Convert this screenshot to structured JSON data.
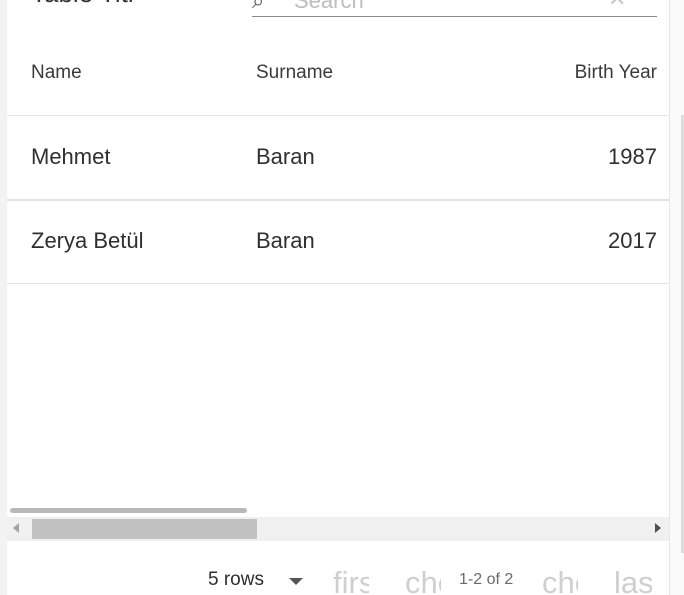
{
  "table": {
    "title": "Table Titl",
    "search": {
      "icon": "search-icon",
      "placeholder": "Search",
      "clear_icon": "clear-icon"
    },
    "columns": [
      "Name",
      "Surname",
      "Birth Year"
    ],
    "rows": [
      {
        "name": "Mehmet",
        "surname": "Baran",
        "birth_year": "1987"
      },
      {
        "name": "Zerya Betül",
        "surname": "Baran",
        "birth_year": "2017"
      }
    ]
  },
  "pagination": {
    "rows_per_page": "5 rows",
    "first_label": "first_page",
    "prev_label": "chevron_left",
    "next_label": "chevron_right",
    "last_label": "last_page",
    "range": "1-2 of 2"
  }
}
